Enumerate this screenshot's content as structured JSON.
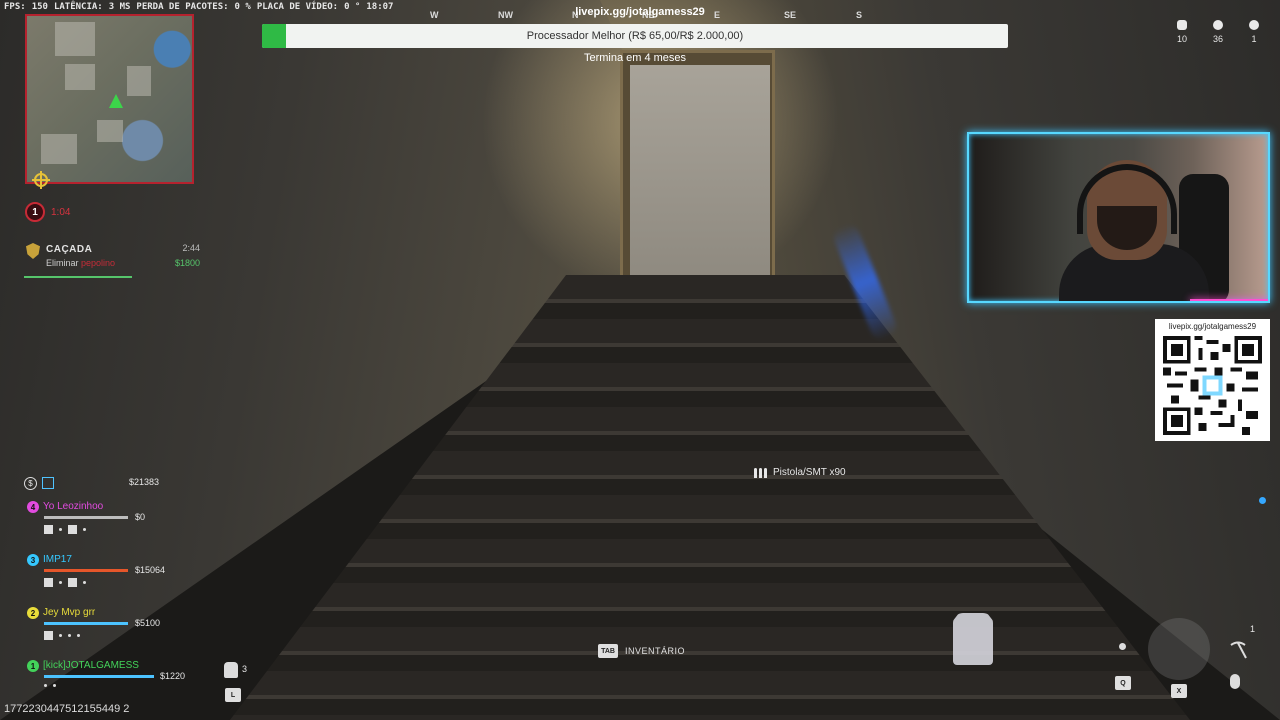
{
  "performance": {
    "fps_label": "FPS:",
    "fps_value": "150",
    "latency_label": "LATÊNCIA:",
    "latency_value": "3 MS",
    "packet_loss_label": "PERDA DE PACOTES:",
    "packet_loss_value": "0 %",
    "gpu_label": "PLACA DE VÍDEO:",
    "gpu_value": "0 °",
    "clock": "18:07"
  },
  "compass": [
    "W",
    "NW",
    "N",
    "NE",
    "E",
    "SE",
    "S"
  ],
  "livepix": {
    "top_url": "livepix.gg/jotalgamess29",
    "goal_label": "Processador Melhor (R$ 65,00/R$ 2.000,00)",
    "goal_progress_percent": 3.25,
    "goal_remaining": "Termina em 4 meses",
    "qr_url": "livepix.gg/jotalgamess29"
  },
  "match": {
    "timer": "1:04",
    "timer_badge": "1",
    "counters": [
      {
        "icon": "squads-icon",
        "value": "10"
      },
      {
        "icon": "players-icon",
        "value": "36"
      },
      {
        "icon": "kills-icon",
        "value": "1"
      }
    ]
  },
  "contract": {
    "title": "CAÇADA",
    "time_left": "2:44",
    "desc_prefix": "Eliminar",
    "target": "pepolino",
    "reward": "$1800"
  },
  "weapon": {
    "label": "Pistola/SMT x90"
  },
  "squad": {
    "team_cash": "$21383",
    "members": [
      {
        "num": "4",
        "name": "Yo Leozinhoo",
        "cash": "$0",
        "color": "#e24be0",
        "health_percent": 100,
        "bar_color": "#bdbdbd"
      },
      {
        "num": "3",
        "name": "IMP17",
        "cash": "$15064",
        "color": "#35c8ff",
        "health_percent": 100,
        "bar_color": "#e6562a"
      },
      {
        "num": "2",
        "name": "Jey Mvp grr",
        "cash": "$5100",
        "color": "#e8dc3a",
        "health_percent": 100,
        "bar_color": "#4cc3ff"
      },
      {
        "num": "1",
        "name": "[kick]JOTALGAMESS",
        "cash": "$1220",
        "color": "#43d35a",
        "health_percent": 100,
        "bar_color": "#4cc3ff"
      }
    ]
  },
  "hud_bottom": {
    "plates_count": "3",
    "plate_key": "L",
    "inventory_key": "TAB",
    "inventory_label": "INVENTÁRIO",
    "lethal_key": "Q",
    "tactical_key": "X",
    "pickaxe_count": "1"
  },
  "session_id": "1772230447512155449 2"
}
